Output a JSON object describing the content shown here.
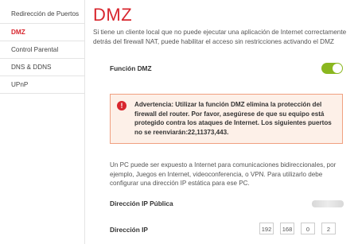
{
  "sidebar": {
    "items": [
      {
        "label": "Redirección de Puertos",
        "active": false
      },
      {
        "label": "DMZ",
        "active": true
      },
      {
        "label": "Control Parental",
        "active": false
      },
      {
        "label": "DNS & DDNS",
        "active": false
      },
      {
        "label": "UPnP",
        "active": false
      }
    ]
  },
  "main": {
    "title": "DMZ",
    "description": "Si tiene un cliente local que no puede ejecutar una aplicación de Internet correctamente detrás del firewall NAT, puede habilitar el acceso sin restricciones activando el DMZ",
    "dmz_function": {
      "label": "Función DMZ",
      "enabled": true
    },
    "warning": {
      "icon": "exclamation-icon",
      "text": "Advertencia: Utilizar la función DMZ elimina la protección del firewall del router. Por favor, asegúrese de que su equipo está protegido contra los ataques de Internet. Los siguientes puertos no se reenviarán:22,11373,443."
    },
    "info": "Un PC puede ser expuesto a Internet para comunicaciones bidireccionales, por ejemplo, Juegos en Internet, videoconferencia, o VPN. Para utilizarlo debe configurar una dirección IP estática para ese PC.",
    "public_ip": {
      "label": "Dirección IP Pública"
    },
    "ip_address": {
      "label": "Dirección IP",
      "octets": [
        "192",
        "168",
        "0",
        "2"
      ]
    }
  },
  "colors": {
    "accent": "#d8262e",
    "toggle_on": "#8ab71f",
    "warning_bg": "#fdf0e8",
    "warning_border": "#f0a080"
  }
}
